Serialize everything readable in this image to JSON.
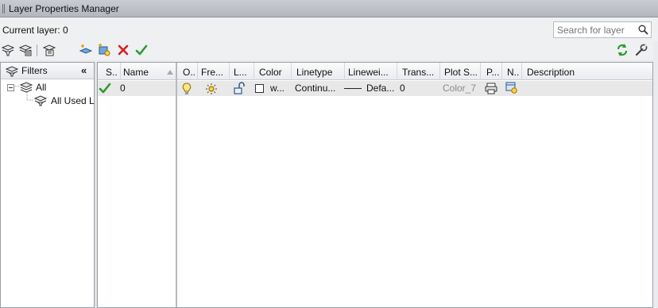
{
  "window": {
    "title": "Layer Properties Manager"
  },
  "status": {
    "current_layer": "Current layer: 0"
  },
  "search": {
    "placeholder": "Search for layer"
  },
  "toolbar": {
    "left_icons": [
      "new-property-filter-icon",
      "new-group-filter-icon",
      "layer-states-manager-icon",
      "new-layer-icon",
      "new-layer-vp-frozen-icon",
      "delete-layer-icon",
      "set-current-icon"
    ],
    "right_icons": [
      "refresh-icon",
      "settings-icon"
    ]
  },
  "filters": {
    "header": "Filters",
    "tree": [
      {
        "label": "All",
        "expanded": true
      },
      {
        "label": "All Used L"
      }
    ]
  },
  "grid": {
    "columns": [
      "S..",
      "Name",
      "O..",
      "Fre...",
      "L...",
      "Color",
      "Linetype",
      "Linewei...",
      "Trans...",
      "Plot S...",
      "P...",
      "N..",
      "Description"
    ],
    "rows": [
      {
        "status": "current",
        "name": "0",
        "on": "lightbulb-on-icon",
        "freeze": "sun-icon",
        "lock": "unlocked-padlock-icon",
        "color_label": "w...",
        "color_swatch": "#ffffff",
        "linetype": "Continu...",
        "lineweight": "Defa...",
        "transparency": "0",
        "plot_style": "Color_7",
        "plot": "printer-icon",
        "new_vp_freeze": "new-vp-freeze-icon",
        "description": ""
      }
    ]
  },
  "colors": {
    "accent_green": "#2e9a2e",
    "delete_red": "#d22020",
    "selection_row": "#e8e8e8"
  }
}
